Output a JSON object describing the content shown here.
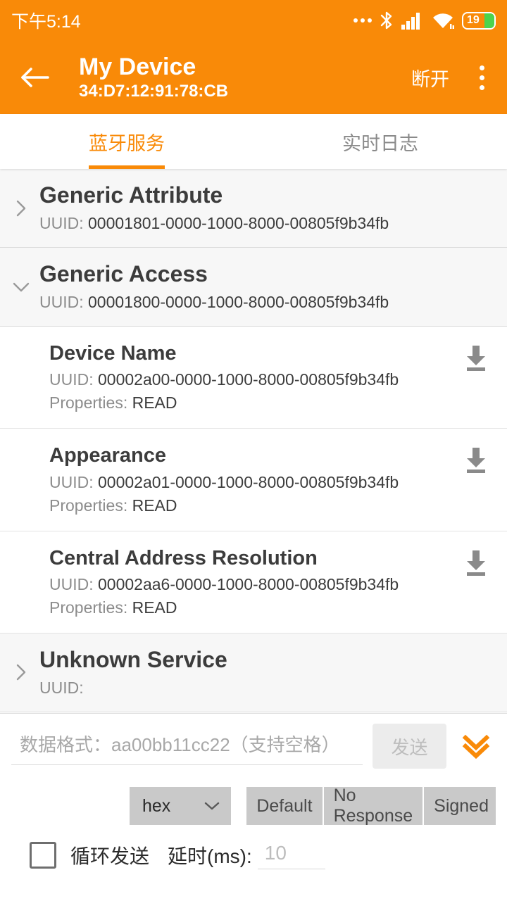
{
  "theme": {
    "accent": "#F98A08",
    "header_bg": "#F98A08",
    "text_dark": "#3c3c3c",
    "text_muted": "#8c8c8c",
    "battery_fill": "#4CD34C"
  },
  "statusbar": {
    "time": "下午5:14",
    "icons": [
      "more-dots-icon",
      "bluetooth-icon",
      "cellular-signal-icon",
      "wifi-icon",
      "battery-icon"
    ],
    "battery_level": "19"
  },
  "appbar": {
    "back_icon": "back-arrow-icon",
    "title": "My Device",
    "subtitle": "34:D7:12:91:78:CB",
    "disconnect_label": "断开",
    "overflow_icon": "overflow-menu-icon"
  },
  "tabs": [
    {
      "label": "蓝牙服务",
      "active": true
    },
    {
      "label": "实时日志",
      "active": false
    }
  ],
  "services": [
    {
      "name": "Generic Attribute",
      "uuid_label": "UUID:",
      "uuid": "00001801-0000-1000-8000-00805f9b34fb",
      "expanded": false,
      "chevron": "chevron-right-icon",
      "characteristics": []
    },
    {
      "name": "Generic Access",
      "uuid_label": "UUID:",
      "uuid": "00001800-0000-1000-8000-00805f9b34fb",
      "expanded": true,
      "chevron": "chevron-down-icon",
      "characteristics": [
        {
          "name": "Device Name",
          "uuid_label": "UUID:",
          "uuid": "00002a00-0000-1000-8000-00805f9b34fb",
          "props_label": "Properties:",
          "props": "READ",
          "action_icon": "download-icon"
        },
        {
          "name": "Appearance",
          "uuid_label": "UUID:",
          "uuid": "00002a01-0000-1000-8000-00805f9b34fb",
          "props_label": "Properties:",
          "props": "READ",
          "action_icon": "download-icon"
        },
        {
          "name": "Central Address Resolution",
          "uuid_label": "UUID:",
          "uuid": "00002aa6-0000-1000-8000-00805f9b34fb",
          "props_label": "Properties:",
          "props": "READ",
          "action_icon": "download-icon"
        }
      ]
    },
    {
      "name": "Unknown Service",
      "uuid_label": "UUID:",
      "uuid": "",
      "expanded": false,
      "chevron": "chevron-right-icon",
      "characteristics": []
    }
  ],
  "write_panel": {
    "data_placeholder": "数据格式：aa00bb11cc22（支持空格）",
    "data_value": "",
    "send_label": "发送",
    "expand_icon": "double-chevron-down-icon",
    "format_select": {
      "value": "hex",
      "chevron": "chevron-down-icon"
    },
    "write_modes": [
      "Default",
      "No Response",
      "Signed"
    ],
    "loop_checkbox": {
      "label": "循环发送",
      "checked": false
    },
    "delay_label": "延时(ms):",
    "delay_placeholder": "10",
    "delay_value": ""
  }
}
